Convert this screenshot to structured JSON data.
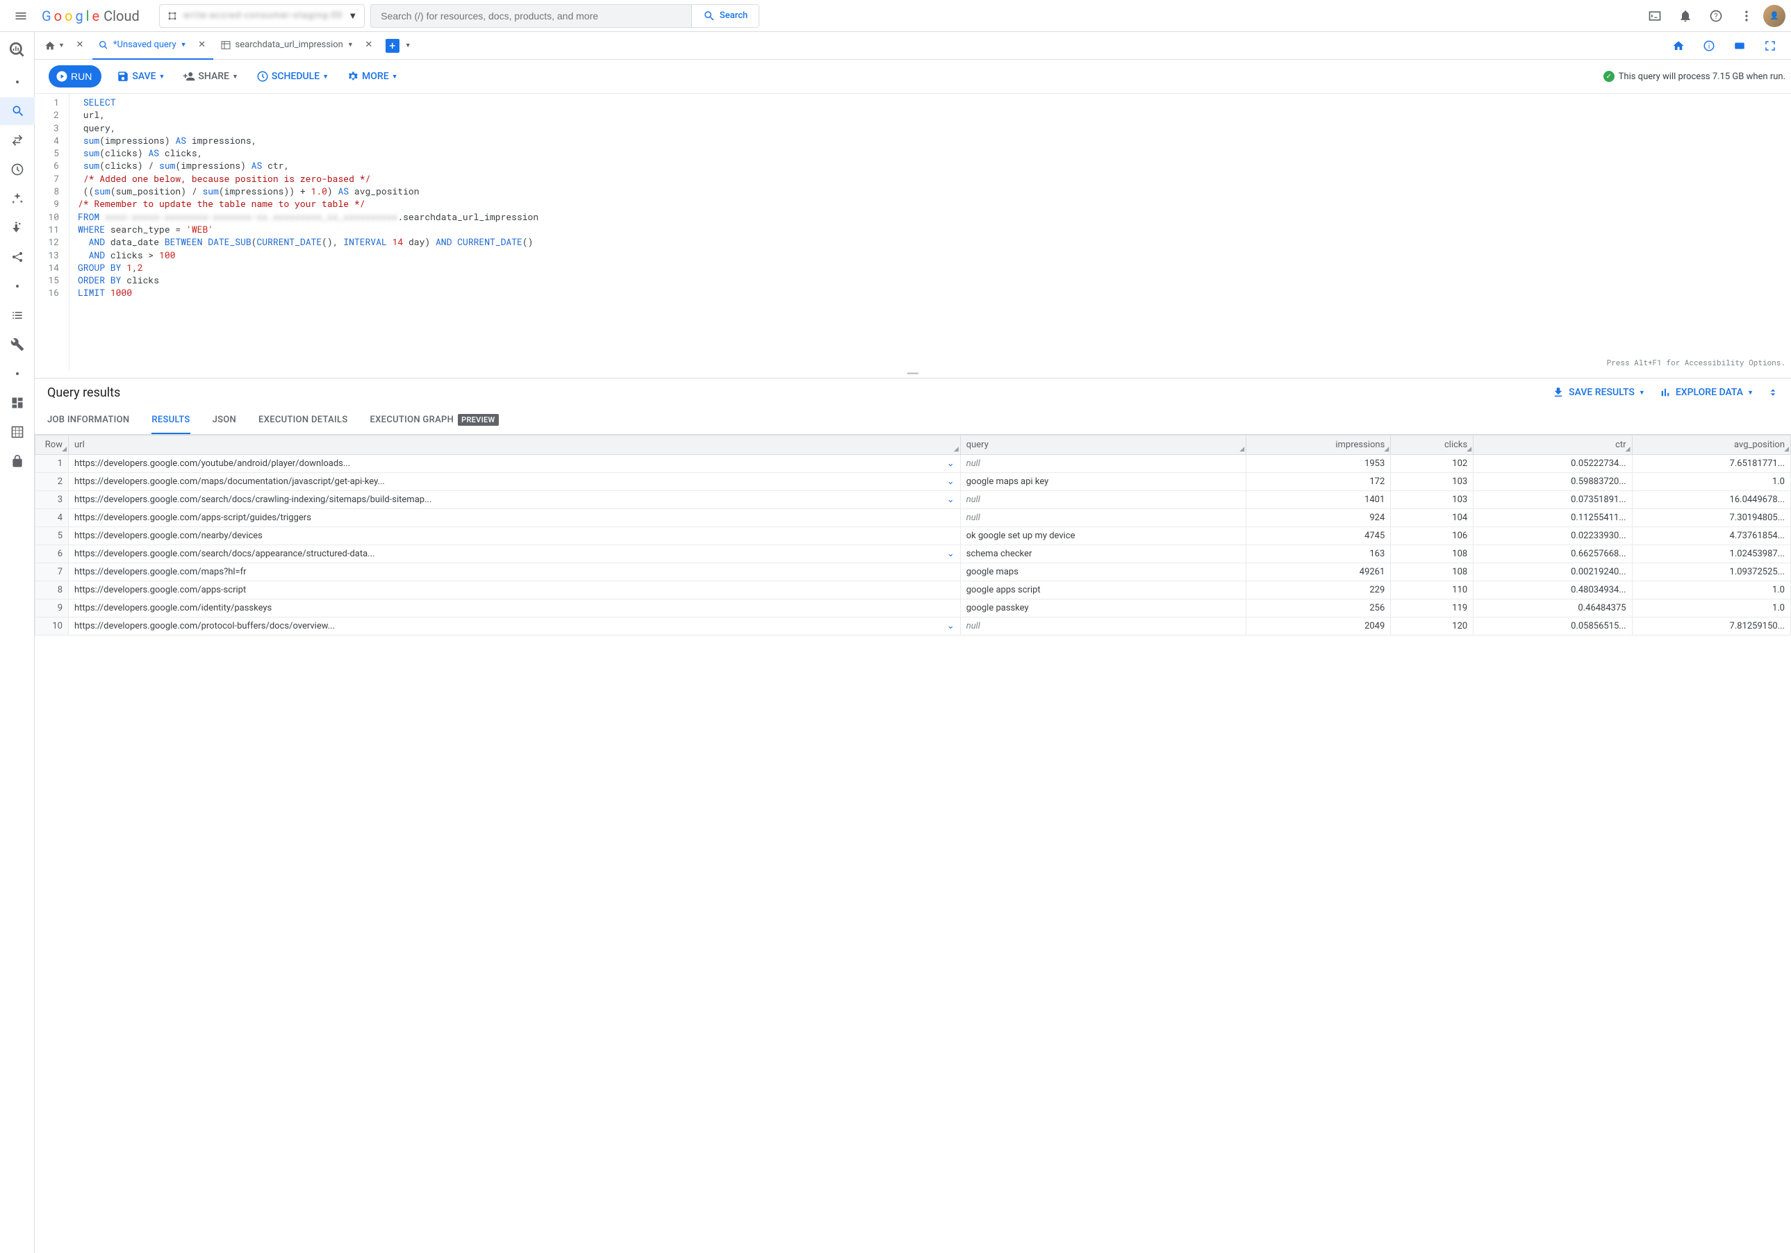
{
  "header": {
    "logo_cloud": "Cloud",
    "project_name_blur": "write-accred-consumer-staging-00",
    "search_placeholder": "Search (/) for resources, docs, products, and more",
    "search_button": "Search"
  },
  "tabs": {
    "unsaved_label": "*Unsaved query",
    "table_label": "searchdata_url_impression"
  },
  "toolbar": {
    "run": "RUN",
    "save": "SAVE",
    "share": "SHARE",
    "schedule": "SCHEDULE",
    "more": "MORE",
    "process_msg": "This query will process 7.15 GB when run."
  },
  "editor": {
    "accessibility_hint": "Press Alt+F1 for Accessibility Options.",
    "sql": {
      "table_suffix": ".searchdata_url_impression",
      "search_type": "'WEB'",
      "interval_days": "14",
      "clicks_gt": "100",
      "limit": "1000",
      "offset": "1.0"
    }
  },
  "results": {
    "title": "Query results",
    "save_results": "SAVE RESULTS",
    "explore_data": "EXPLORE DATA",
    "tabs": {
      "job_info": "JOB INFORMATION",
      "results": "RESULTS",
      "json": "JSON",
      "execution_details": "EXECUTION DETAILS",
      "execution_graph": "EXECUTION GRAPH",
      "preview_badge": "PREVIEW"
    },
    "columns": {
      "row": "Row",
      "url": "url",
      "query": "query",
      "impressions": "impressions",
      "clicks": "clicks",
      "ctr": "ctr",
      "avg_position": "avg_position"
    },
    "rows": [
      {
        "n": "1",
        "url": "https://developers.google.com/youtube/android/player/downloads...",
        "query": null,
        "impressions": "1953",
        "clicks": "102",
        "ctr": "0.05222734...",
        "avg": "7.65181771...",
        "exp": true
      },
      {
        "n": "2",
        "url": "https://developers.google.com/maps/documentation/javascript/get-api-key...",
        "query": "google maps api key",
        "impressions": "172",
        "clicks": "103",
        "ctr": "0.59883720...",
        "avg": "1.0",
        "exp": true
      },
      {
        "n": "3",
        "url": "https://developers.google.com/search/docs/crawling-indexing/sitemaps/build-sitemap...",
        "query": null,
        "impressions": "1401",
        "clicks": "103",
        "ctr": "0.07351891...",
        "avg": "16.0449678...",
        "exp": true
      },
      {
        "n": "4",
        "url": "https://developers.google.com/apps-script/guides/triggers",
        "query": null,
        "impressions": "924",
        "clicks": "104",
        "ctr": "0.11255411...",
        "avg": "7.30194805...",
        "exp": false
      },
      {
        "n": "5",
        "url": "https://developers.google.com/nearby/devices",
        "query": "ok google set up my device",
        "impressions": "4745",
        "clicks": "106",
        "ctr": "0.02233930...",
        "avg": "4.73761854...",
        "exp": false
      },
      {
        "n": "6",
        "url": "https://developers.google.com/search/docs/appearance/structured-data...",
        "query": "schema checker",
        "impressions": "163",
        "clicks": "108",
        "ctr": "0.66257668...",
        "avg": "1.02453987...",
        "exp": true
      },
      {
        "n": "7",
        "url": "https://developers.google.com/maps?hl=fr",
        "query": "google maps",
        "impressions": "49261",
        "clicks": "108",
        "ctr": "0.00219240...",
        "avg": "1.09372525...",
        "exp": false
      },
      {
        "n": "8",
        "url": "https://developers.google.com/apps-script",
        "query": "google apps script",
        "impressions": "229",
        "clicks": "110",
        "ctr": "0.48034934...",
        "avg": "1.0",
        "exp": false
      },
      {
        "n": "9",
        "url": "https://developers.google.com/identity/passkeys",
        "query": "google passkey",
        "impressions": "256",
        "clicks": "119",
        "ctr": "0.46484375",
        "avg": "1.0",
        "exp": false
      },
      {
        "n": "10",
        "url": "https://developers.google.com/protocol-buffers/docs/overview...",
        "query": null,
        "impressions": "2049",
        "clicks": "120",
        "ctr": "0.05856515...",
        "avg": "7.81259150...",
        "exp": true
      }
    ]
  }
}
